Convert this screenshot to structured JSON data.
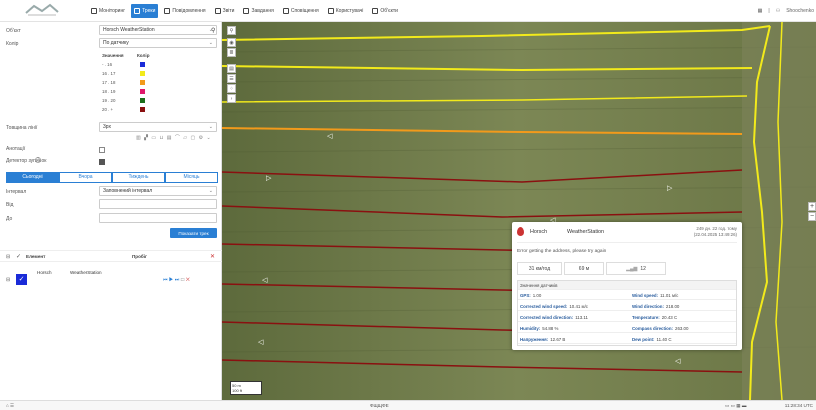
{
  "nav": {
    "items": [
      {
        "label": "Моніторинг",
        "icon": "monitor-icon",
        "active": false
      },
      {
        "label": "Треки",
        "icon": "route-icon",
        "active": true
      },
      {
        "label": "Повідомлення",
        "icon": "messages-icon",
        "active": false
      },
      {
        "label": "Звіти",
        "icon": "reports-icon",
        "active": false
      },
      {
        "label": "Завдання",
        "icon": "tasks-icon",
        "active": false
      },
      {
        "label": "Сповіщення",
        "icon": "notifications-icon",
        "active": false
      },
      {
        "label": "Користувачі",
        "icon": "users-icon",
        "active": false
      },
      {
        "label": "Об'єкти",
        "icon": "objects-icon",
        "active": false
      }
    ],
    "user": "Shoochenko"
  },
  "form": {
    "object_label": "Об'єкт",
    "object_value": "Horsch     WeatherStation",
    "color_label": "Колір",
    "color_value": "По датчику",
    "legend_headers": [
      "Значення",
      "Колір"
    ],
    "legend": [
      {
        "range": "- . 16",
        "color": "#1a2bd8"
      },
      {
        "range": "16 . 17",
        "color": "#f2ea1b"
      },
      {
        "range": "17 . 18",
        "color": "#f29a1b"
      },
      {
        "range": "18 . 19",
        "color": "#e0186b"
      },
      {
        "range": "19 . 20",
        "color": "#1c6e1c"
      },
      {
        "range": "20 . +",
        "color": "#8a1010"
      }
    ],
    "thickness_label": "Товщина лінії",
    "thickness_value": "3px",
    "annotations_label": "Анотації",
    "marker_label": "Детектор зупинок",
    "tabs": [
      "Сьогодні",
      "Вчора",
      "Тиждень",
      "Місяць"
    ],
    "interval_label": "Інтервал",
    "interval_value": "Заповнений інтервал",
    "from_label": "Від",
    "to_label": "До",
    "show_button": "Показати трек"
  },
  "tracks": {
    "element_header": "Елемент",
    "mileage_header": "Пробіг",
    "item_name": "Horsch",
    "item_sub": "WeatherStation"
  },
  "popup": {
    "name": "Horsch",
    "sub": "WeatherStation",
    "time": "249 дн. 22 год. тому",
    "date": "(22.04.2025 13:49:26)",
    "error": "Error getting the address, please try again",
    "stats": [
      "31 км/год",
      "69 м",
      "12"
    ],
    "sensors_title": "Значення датчиків",
    "sensors": [
      {
        "k": "GPS:",
        "v": "1.00"
      },
      {
        "k": "Wind speed:",
        "v": "11.01 м/с"
      },
      {
        "k": "Corrected wind speed:",
        "v": "10.41 м/с"
      },
      {
        "k": "Wind direction:",
        "v": "218.00"
      },
      {
        "k": "Corrected wind direction:",
        "v": "113.11"
      },
      {
        "k": "Temperature:",
        "v": "20.43 С"
      },
      {
        "k": "Humidity:",
        "v": "54.88 %"
      },
      {
        "k": "Compass direction:",
        "v": "263.00"
      },
      {
        "k": "Напруження:",
        "v": "12.67 В"
      },
      {
        "k": "Dew point:",
        "v": "11.40 С"
      }
    ]
  },
  "map": {
    "scale_label": "50 m",
    "scale_sub": "100 ft"
  },
  "status": {
    "center": "ФЩЩФЕ",
    "time": "11:28:34 UTC"
  }
}
